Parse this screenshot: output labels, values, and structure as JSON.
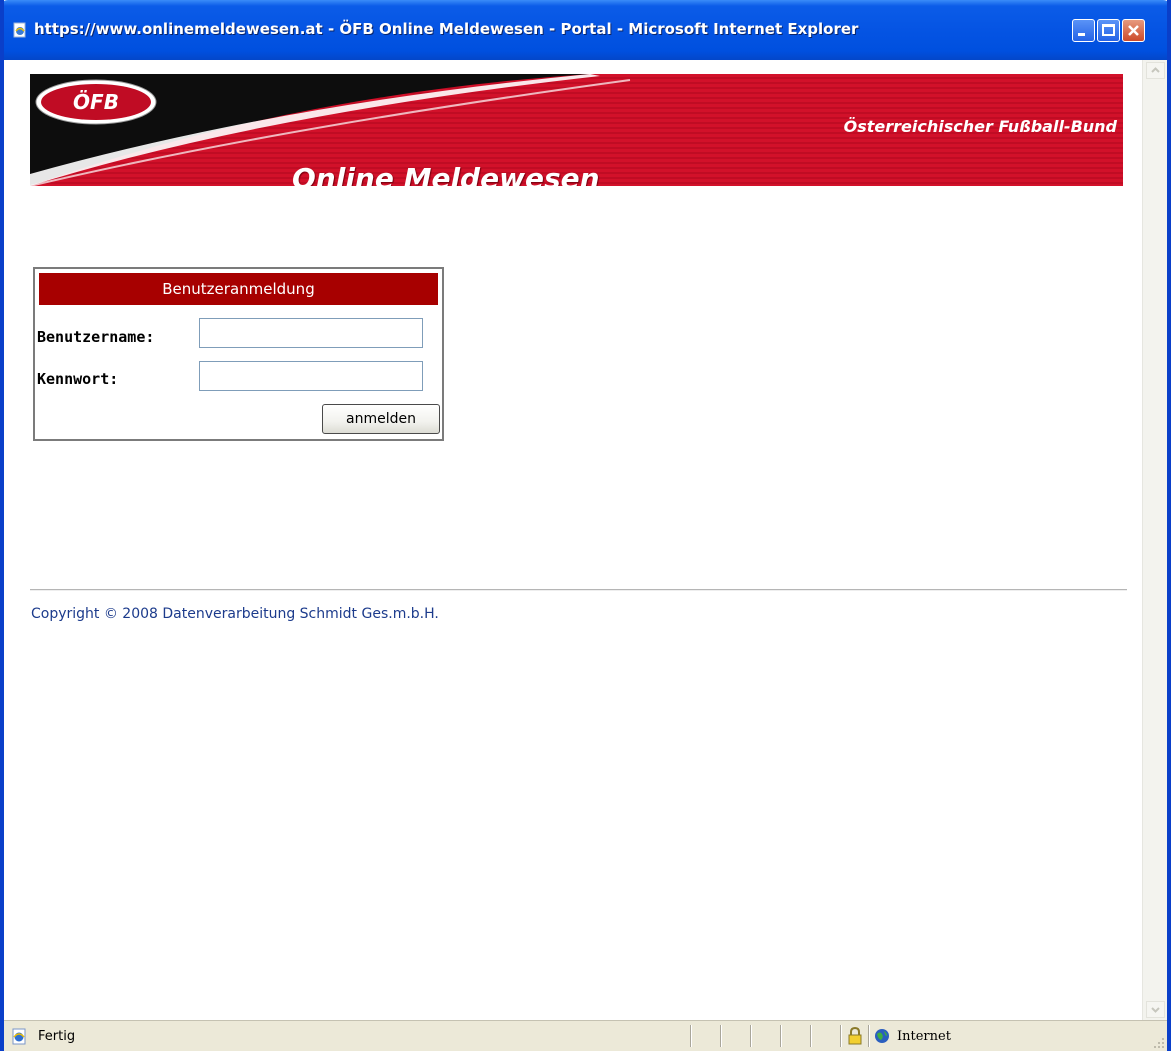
{
  "window": {
    "title": "https://www.onlinemeldewesen.at - ÖFB Online Meldewesen - Portal - Microsoft Internet Explorer"
  },
  "banner": {
    "logo_text": "ÖFB",
    "slogan": "Österreichischer Fußball-Bund",
    "app_title": "Online Meldewesen"
  },
  "login": {
    "header": "Benutzeranmeldung",
    "username_label": "Benutzername:",
    "username_value": "",
    "password_label": "Kennwort:",
    "password_value": "",
    "submit_label": "anmelden"
  },
  "footer": {
    "copyright": "Copyright © 2008 Datenverarbeitung Schmidt Ges.m.b.H."
  },
  "statusbar": {
    "status": "Fertig",
    "zone": "Internet"
  },
  "colors": {
    "titlebar": "#0554e3",
    "banner_red": "#d2112a",
    "login_header": "#a70000",
    "link_blue": "#1c3b8c"
  }
}
